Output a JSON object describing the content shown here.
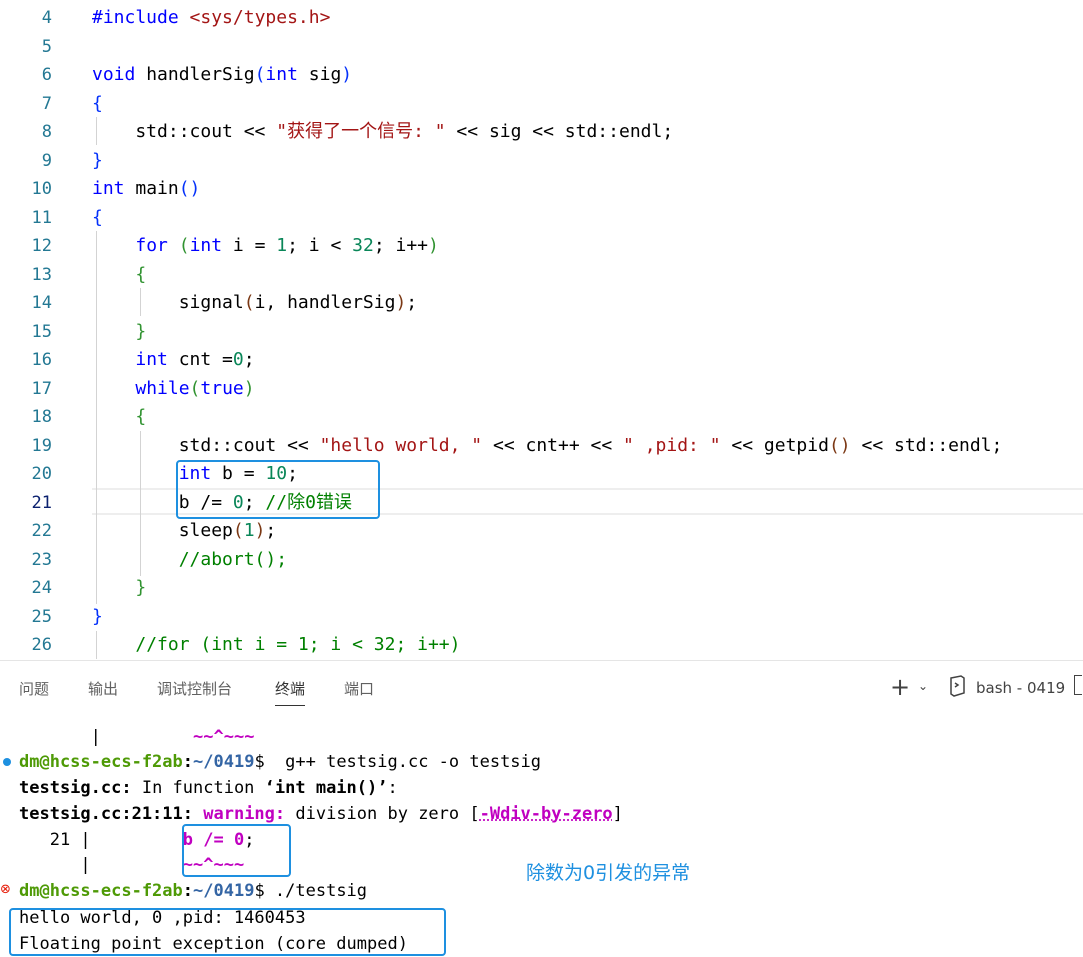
{
  "editor": {
    "lines": [
      {
        "n": "4"
      },
      {
        "n": "5"
      },
      {
        "n": "6"
      },
      {
        "n": "7"
      },
      {
        "n": "8"
      },
      {
        "n": "9"
      },
      {
        "n": "10"
      },
      {
        "n": "11"
      },
      {
        "n": "12"
      },
      {
        "n": "13"
      },
      {
        "n": "14"
      },
      {
        "n": "15"
      },
      {
        "n": "16"
      },
      {
        "n": "17"
      },
      {
        "n": "18"
      },
      {
        "n": "19"
      },
      {
        "n": "20"
      },
      {
        "n": "21"
      },
      {
        "n": "22"
      },
      {
        "n": "23"
      },
      {
        "n": "24"
      },
      {
        "n": "25"
      },
      {
        "n": "26"
      }
    ],
    "current_line": "21"
  },
  "panel": {
    "tabs": [
      "问题",
      "输出",
      "调试控制台",
      "终端",
      "端口"
    ],
    "active_tab": "终端",
    "terminal_name": "bash - 0419",
    "plus_label": "+",
    "chevron_label": "⌄"
  },
  "terminal": {
    "line0_bar": "|",
    "line0_tilde": "~~^~~~",
    "prompt1_user": "dm@hcss-ecs-f2ab",
    "prompt1_path": "~/0419",
    "prompt1_cmd": "$  g++ testsig.cc -o testsig",
    "out1_file": "testsig.cc:",
    "out1_rest": " In function ",
    "out1_fn": "‘int main()’",
    "out1_end": ":",
    "out2_loc": "testsig.cc:21:11:",
    "out2_warn": "warning:",
    "out2_msg": " division by zero [",
    "out2_flag": "-Wdiv-by-zero",
    "out2_close": "]",
    "out3_num": "   21 |",
    "out3_code": "b /= 0",
    "out3_semi": ";",
    "out4_bar": "      |",
    "out4_tilde": "~~^~~~",
    "prompt2_user": "dm@hcss-ecs-f2ab",
    "prompt2_path": "~/0419",
    "prompt2_cmd": "$ ./testsig",
    "out5": "hello world, 0 ,pid: 1460453",
    "out6": "Floating point exception (core dumped)",
    "annotation": "除数为0引发的异常"
  },
  "colors": {
    "annotation_box": "#1e90e0",
    "prompt_user": "#4e9a06",
    "prompt_path": "#3465a4",
    "warning": "#c000c0",
    "error_dot": "#e51400",
    "info_dot": "#1e90e0"
  }
}
